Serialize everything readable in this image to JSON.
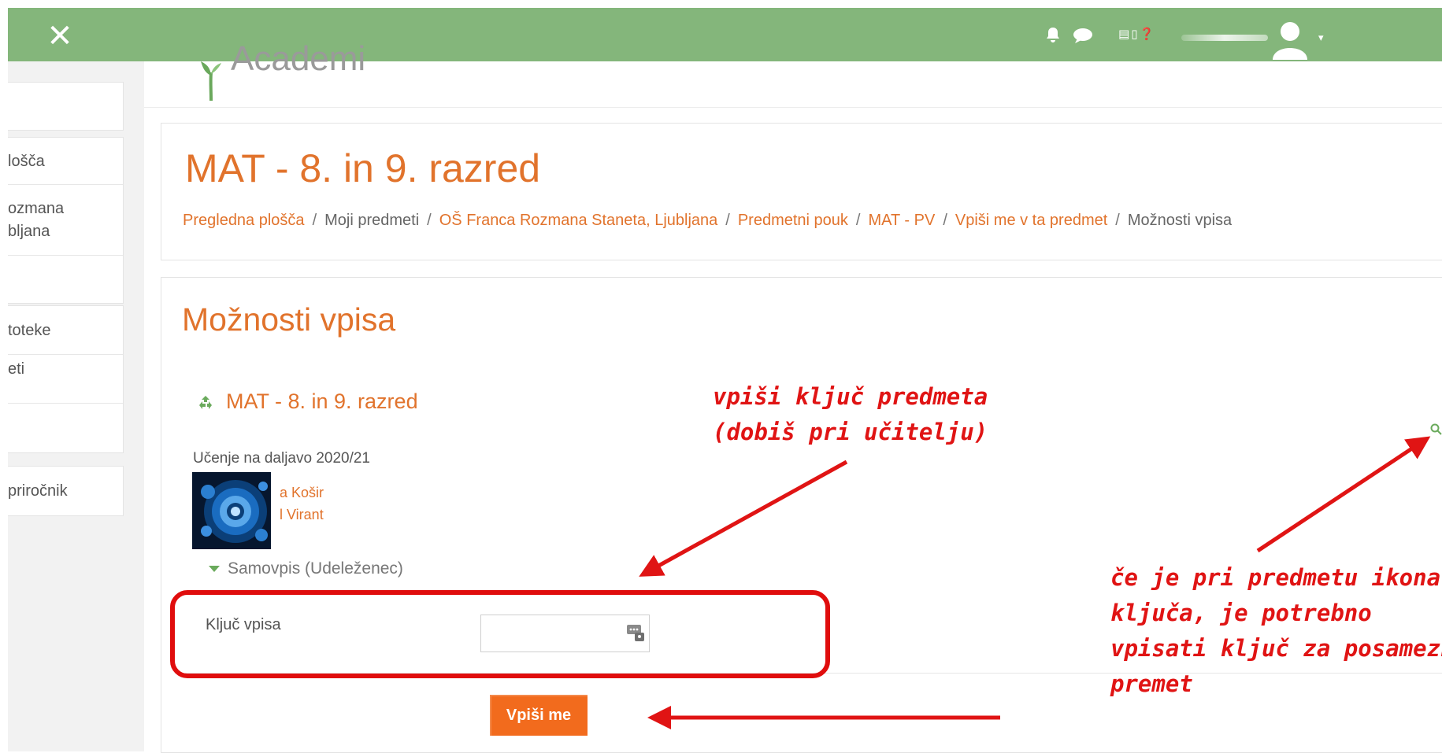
{
  "topbar": {
    "close_icon": "close-icon",
    "icons": [
      "bell-icon",
      "chat-bubble-icon",
      "book-icon",
      "phone-icon",
      "help-icon"
    ],
    "user_menu_caret": "▾",
    "color": "#84b67b"
  },
  "drawer": {
    "groups": [
      {
        "items": [
          ""
        ]
      },
      {
        "items": [
          "lošča",
          "ozmana\nbljana",
          ""
        ]
      },
      {
        "items": [
          "toteke",
          "eti",
          ""
        ]
      },
      {
        "items": [
          "priročnik"
        ]
      }
    ]
  },
  "brand": {
    "text": "Academi"
  },
  "header": {
    "title": "MAT - 8. in 9. razred",
    "breadcrumb": [
      {
        "label": "Pregledna plošča",
        "link": true
      },
      {
        "label": "Moji predmeti",
        "link": false
      },
      {
        "label": "OŠ Franca Rozmana Staneta, Ljubljana",
        "link": true
      },
      {
        "label": "Predmetni pouk",
        "link": true
      },
      {
        "label": "MAT - PV",
        "link": true
      },
      {
        "label": "Vpiši me v ta predmet",
        "link": true
      },
      {
        "label": "Možnosti vpisa",
        "link": false
      }
    ],
    "separator": "/"
  },
  "main": {
    "section_title": "Možnosti vpisa",
    "course_name": "MAT - 8. in 9. razred",
    "summary": "Učenje na daljavo 2020/21",
    "teachers": [
      "a Košir",
      "l Virant"
    ],
    "self_enrol_header": "Samovpis (Udeleženec)",
    "field_label": "Ključ vpisa",
    "field_value": "",
    "field_placeholder": "",
    "submit_label": "Vpiši me"
  },
  "annotations": {
    "top_note": [
      "vpiši ključ predmeta",
      "(dobiš pri učitelju)"
    ],
    "right_note": [
      "če je pri predmetu ikona",
      "ključa, je potrebno",
      "vpisati ključ za posamezni",
      "premet"
    ],
    "color": "#e01414"
  },
  "colors": {
    "accent": "#e1732c",
    "button": "#f26b1d",
    "topbar": "#84b67b"
  }
}
